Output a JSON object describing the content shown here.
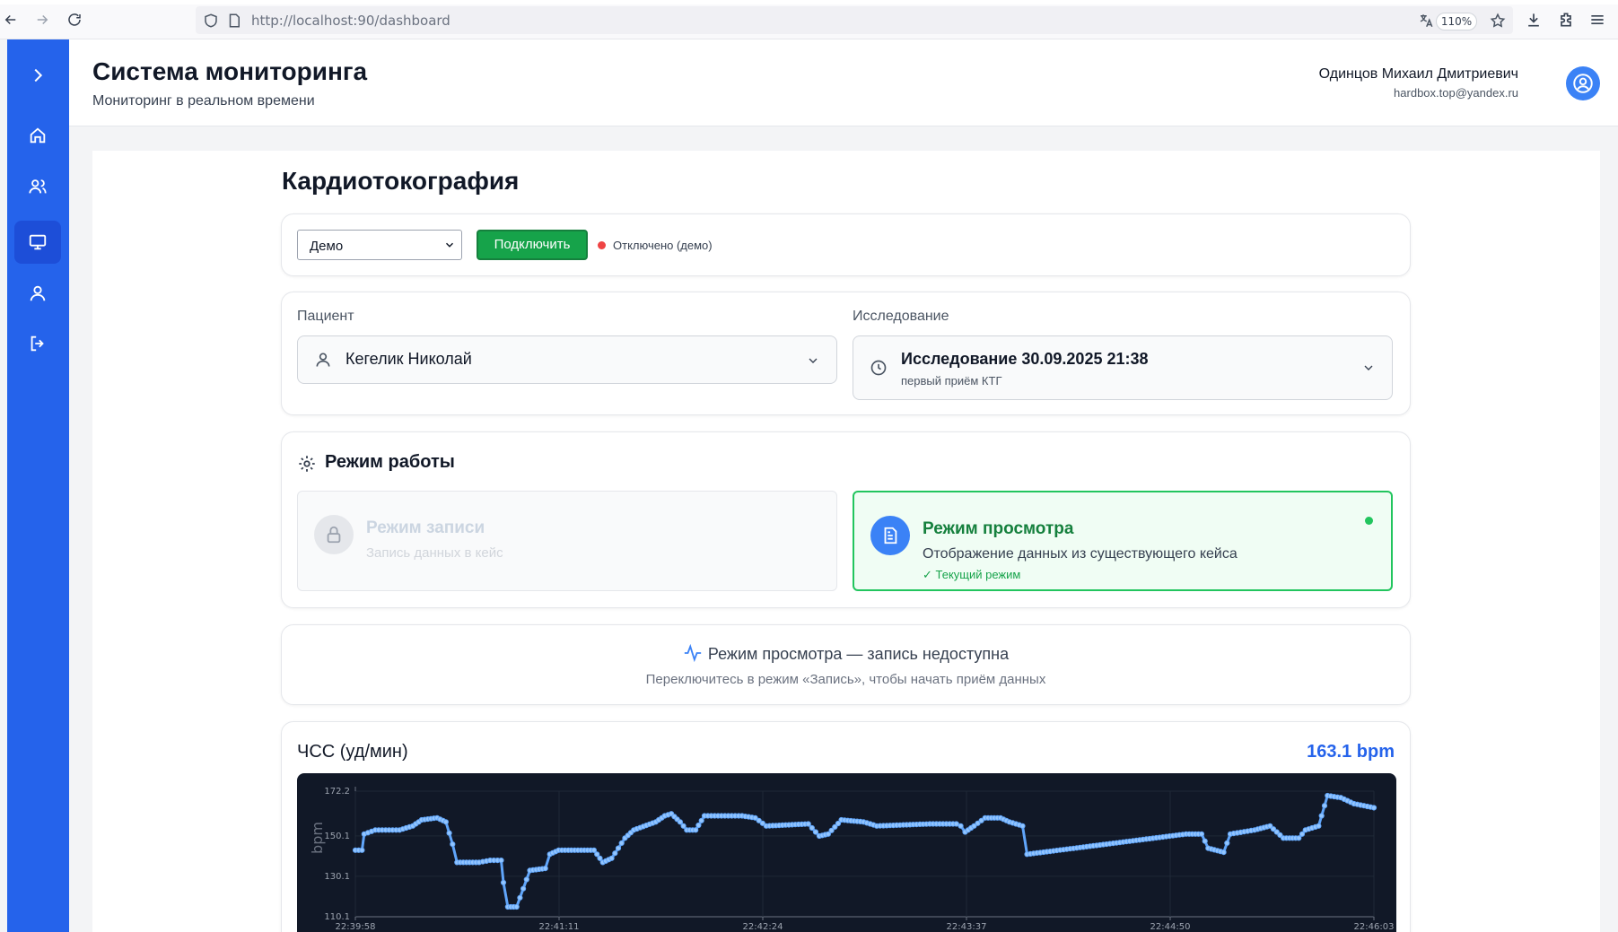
{
  "browser": {
    "url": "http://localhost:90/dashboard",
    "zoom": "110%"
  },
  "header": {
    "title": "Система мониторинга",
    "subtitle": "Мониторинг в реальном времени",
    "user_name": "Одинцов Михаил Дмитриевич",
    "user_email": "hardbox.top@yandex.ru"
  },
  "sidebar": {
    "items": [
      {
        "icon": "home-icon",
        "active": false
      },
      {
        "icon": "users-icon",
        "active": false
      },
      {
        "icon": "monitor-icon",
        "active": true
      },
      {
        "icon": "user-icon",
        "active": false
      },
      {
        "icon": "logout-icon",
        "active": false
      }
    ]
  },
  "page": {
    "title": "Кардиотокография"
  },
  "connection": {
    "source_value": "Демо",
    "connect_label": "Подключить",
    "status_text": "Отключено (демо)",
    "status_color": "#ef4444"
  },
  "selection": {
    "patient_label": "Пациент",
    "patient_value": "Кегелик Николай",
    "study_label": "Исследование",
    "study_value": "Исследование 30.09.2025 21:38",
    "study_note": "первый приём КТГ"
  },
  "mode": {
    "title": "Режим работы",
    "record": {
      "title": "Режим записи",
      "desc": "Запись данных в кейс"
    },
    "view": {
      "title": "Режим просмотра",
      "desc": "Отображение данных из существующего кейса",
      "current": "✓ Текущий режим"
    }
  },
  "notice": {
    "title": "Режим просмотра — запись недоступна",
    "subtitle": "Переключитесь в режим «Запись», чтобы начать приём данных"
  },
  "chart_data": {
    "type": "line",
    "title": "ЧСС (уд/мин)",
    "current_value": "163.1 bpm",
    "ylabel": "bpm",
    "xlabel": "",
    "ylim": [
      110.1,
      172.2
    ],
    "y_ticks": [
      "110.1",
      "130.1",
      "150.1",
      "172.2"
    ],
    "x_ticks": [
      "22:39:58",
      "22:41:11",
      "22:42:24",
      "22:43:37",
      "22:44:50",
      "22:46:03"
    ],
    "x_range_seconds": [
      0,
      365
    ],
    "line_color": "#60a5fa",
    "background": "#111827",
    "series": [
      {
        "name": "",
        "points": [
          [
            0,
            143
          ],
          [
            3,
            143
          ],
          [
            4,
            151
          ],
          [
            9,
            153
          ],
          [
            20,
            153
          ],
          [
            26,
            155
          ],
          [
            30,
            158
          ],
          [
            37,
            159
          ],
          [
            41,
            157
          ],
          [
            44,
            146
          ],
          [
            46,
            137
          ],
          [
            56,
            137
          ],
          [
            61,
            138
          ],
          [
            66,
            138
          ],
          [
            67,
            127
          ],
          [
            69,
            115
          ],
          [
            73,
            115
          ],
          [
            76,
            124
          ],
          [
            79,
            133
          ],
          [
            86,
            134
          ],
          [
            88,
            141
          ],
          [
            92,
            143
          ],
          [
            108,
            143
          ],
          [
            112,
            137
          ],
          [
            116,
            139
          ],
          [
            122,
            149
          ],
          [
            126,
            153
          ],
          [
            136,
            157
          ],
          [
            140,
            160
          ],
          [
            143,
            161
          ],
          [
            147,
            157
          ],
          [
            150,
            153
          ],
          [
            154,
            153
          ],
          [
            158,
            160
          ],
          [
            175,
            160
          ],
          [
            181,
            159
          ],
          [
            186,
            155
          ],
          [
            205,
            156
          ],
          [
            210,
            150
          ],
          [
            214,
            151
          ],
          [
            220,
            158
          ],
          [
            230,
            157
          ],
          [
            236,
            155
          ],
          [
            260,
            156
          ],
          [
            272,
            156
          ],
          [
            274,
            155
          ],
          [
            276,
            152
          ],
          [
            280,
            155
          ],
          [
            285,
            159
          ],
          [
            292,
            159
          ],
          [
            296,
            157
          ],
          [
            302,
            155
          ],
          [
            304,
            141
          ],
          [
            376,
            151
          ],
          [
            383,
            151
          ],
          [
            386,
            144
          ],
          [
            393,
            142
          ],
          [
            396,
            151
          ],
          [
            407,
            153
          ],
          [
            414,
            155
          ],
          [
            420,
            149
          ],
          [
            427,
            149
          ],
          [
            430,
            153
          ],
          [
            436,
            155
          ],
          [
            440,
            170
          ],
          [
            446,
            169
          ],
          [
            452,
            166
          ],
          [
            461,
            164
          ]
        ]
      }
    ]
  }
}
